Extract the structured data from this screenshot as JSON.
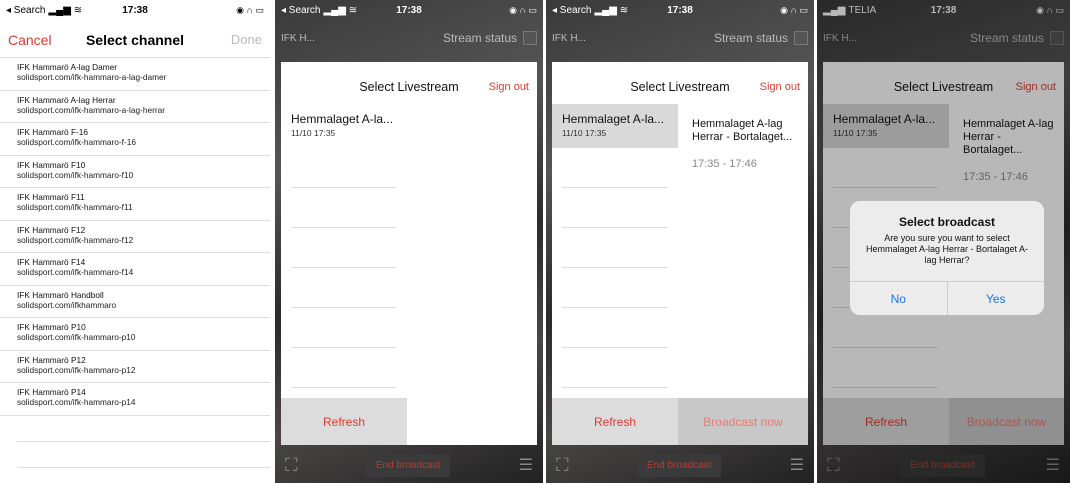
{
  "colors": {
    "accent": "#e03a2e",
    "link": "#1a73e8"
  },
  "screen1": {
    "status": {
      "back": "◂ Search",
      "time": "17:38"
    },
    "header": {
      "cancel": "Cancel",
      "title": "Select channel",
      "done": "Done"
    },
    "channels": [
      {
        "name": "IFK Hammarö A-lag Damer",
        "url": "solidsport.com/ifk-hammaro-a-lag-damer"
      },
      {
        "name": "IFK Hammarö A-lag Herrar",
        "url": "solidsport.com/ifk-hammaro-a-lag-herrar"
      },
      {
        "name": "IFK Hammarö F-16",
        "url": "solidsport.com/ifk-hammaro-f-16"
      },
      {
        "name": "IFK Hammarö F10",
        "url": "solidsport.com/ifk-hammaro-f10"
      },
      {
        "name": "IFK Hammarö F11",
        "url": "solidsport.com/ifk-hammaro-f11"
      },
      {
        "name": "IFK Hammarö F12",
        "url": "solidsport.com/ifk-hammaro-f12"
      },
      {
        "name": "IFK Hammarö F14",
        "url": "solidsport.com/ifk-hammaro-f14"
      },
      {
        "name": "IFK Hammarö Handboll",
        "url": "solidsport.com/ifkhammaro"
      },
      {
        "name": "IFK Hammarö P10",
        "url": "solidsport.com/ifk-hammaro-p10"
      },
      {
        "name": "IFK Hammarö P12",
        "url": "solidsport.com/ifk-hammaro-p12"
      },
      {
        "name": "IFK Hammarö P14",
        "url": "solidsport.com/ifk-hammaro-p14"
      }
    ]
  },
  "common": {
    "team_short": "IFK H...",
    "stream_status": "Stream status",
    "select_livestream": "Select Livestream",
    "sign_out": "Sign out",
    "event_title": "Hemmalaget A-la...",
    "event_date": "11/10 17:35",
    "detail_title": "Hemmalaget A-lag Herrar - Bortalaget...",
    "detail_time": "17:35 - 17:46",
    "refresh": "Refresh",
    "broadcast_now": "Broadcast now",
    "end_broadcast": "End broadcast"
  },
  "screen2": {
    "status": {
      "back": "◂ Search",
      "time": "17:38"
    }
  },
  "screen3": {
    "status": {
      "back": "◂ Search",
      "time": "17:38"
    }
  },
  "screen4": {
    "status": {
      "back": "TELIA",
      "time": "17:38"
    },
    "alert": {
      "title": "Select broadcast",
      "message": "Are you sure you want to select Hemmalaget A-lag Herrar - Bortalaget A-lag Herrar?",
      "no": "No",
      "yes": "Yes"
    }
  }
}
